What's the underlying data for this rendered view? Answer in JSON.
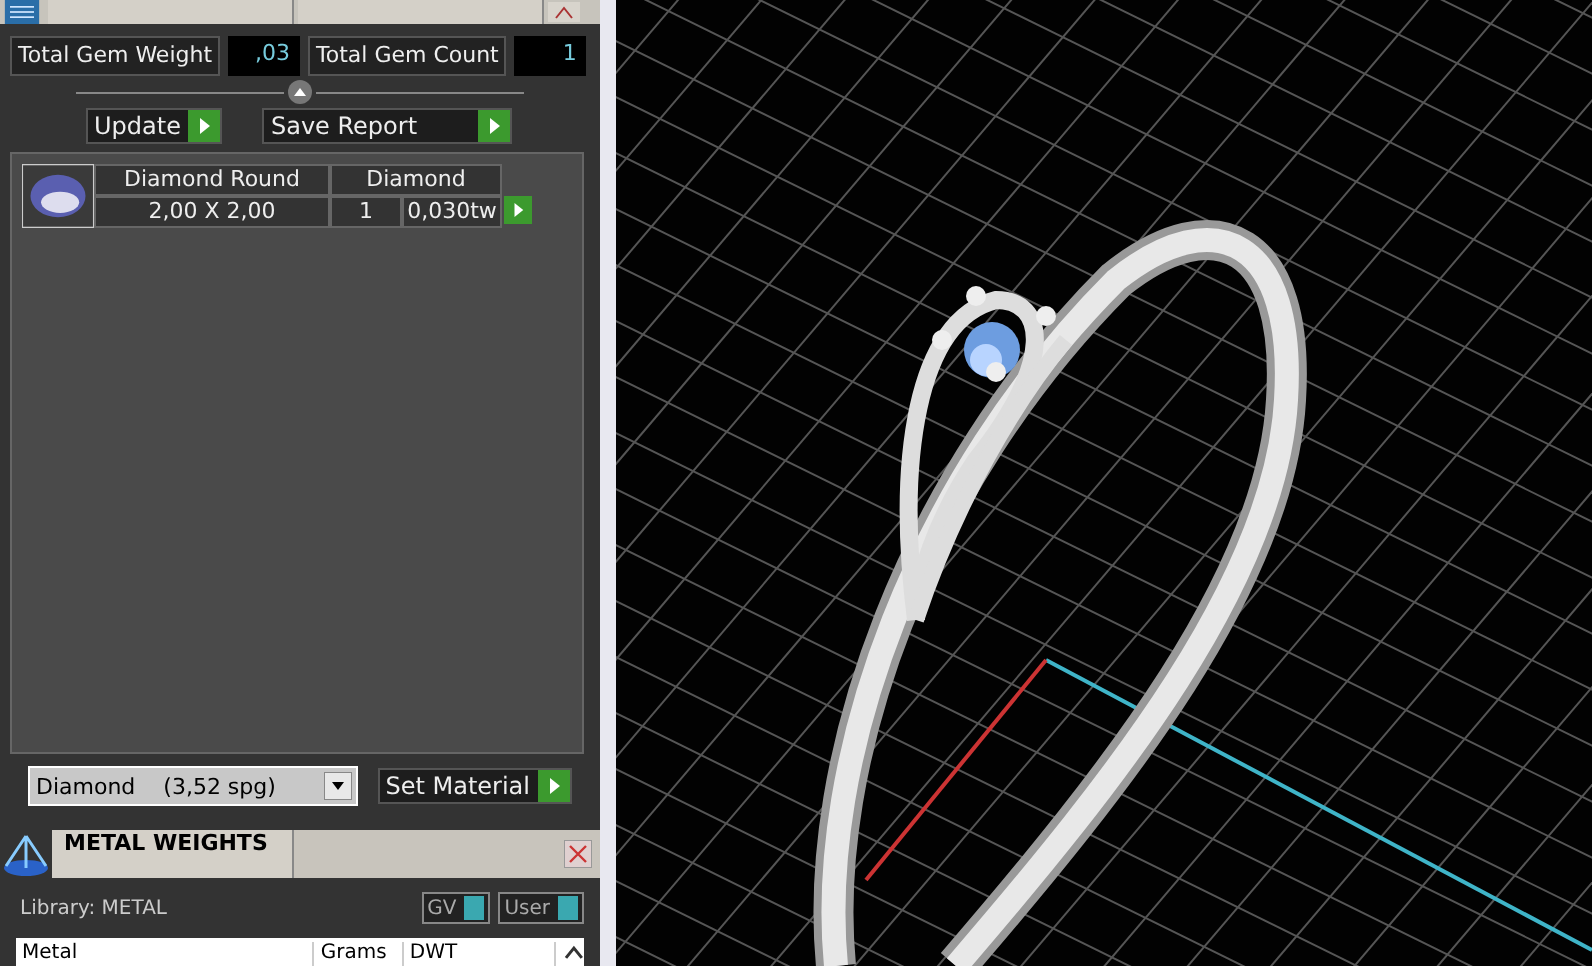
{
  "gem_summary": {
    "weight_label": "Total Gem Weight",
    "weight_value": ",03",
    "count_label": "Total Gem Count",
    "count_value": "1"
  },
  "buttons": [
    "Update",
    "Save Report"
  ],
  "gems": [
    {
      "name": "Diamond Round",
      "material": "Diamond",
      "size": "2,00 X 2,00",
      "count": "1",
      "weight": "0,030tw"
    }
  ],
  "material_select": {
    "value": "Diamond    (3,52 spg)"
  },
  "set_button": "Set Material",
  "metal_weights": {
    "title": "METAL WEIGHTS",
    "library": "Library: METAL",
    "toggles": [
      {
        "label": "GV",
        "on": true
      },
      {
        "label": "User",
        "on": true
      }
    ],
    "columns": [
      "Metal",
      "Grams",
      "DWT"
    ]
  }
}
